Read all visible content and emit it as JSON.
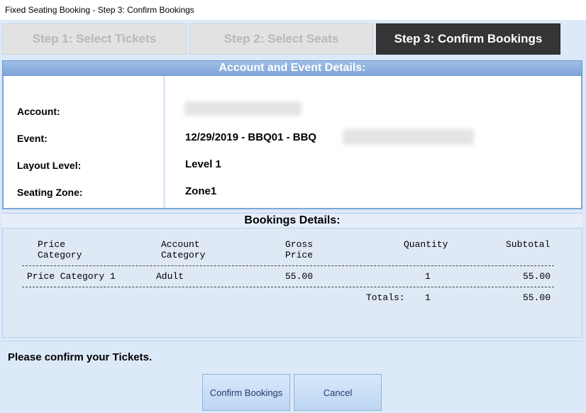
{
  "window": {
    "title": "Fixed Seating Booking - Step 3: Confirm Bookings"
  },
  "steps": [
    {
      "label": "Step 1: Select Tickets",
      "state": "inactive"
    },
    {
      "label": "Step 2: Select Seats",
      "state": "inactive"
    },
    {
      "label": "Step 3: Confirm Bookings",
      "state": "active"
    }
  ],
  "account_section": {
    "header": "Account and Event Details:",
    "fields": {
      "account_label": "Account:",
      "event_label": "Event:",
      "layout_label": "Layout Level:",
      "zone_label": "Seating Zone:",
      "event_value": "12/29/2019 - BBQ01 - BBQ",
      "layout_value": "Level 1",
      "zone_value": "Zone1"
    }
  },
  "bookings_section": {
    "header": "Bookings Details:",
    "columns": {
      "price_category": [
        "Price",
        "Category"
      ],
      "account_category": [
        "Account",
        "Category"
      ],
      "gross_price": [
        "Gross",
        "Price"
      ],
      "quantity": "Quantity",
      "subtotal": "Subtotal"
    },
    "rows": [
      {
        "price_category": "Price Category 1",
        "account_category": "Adult",
        "gross_price": "55.00",
        "quantity": "1",
        "subtotal": "55.00"
      }
    ],
    "totals": {
      "label": "Totals:",
      "quantity": "1",
      "subtotal": "55.00"
    }
  },
  "status_message": "Please confirm your Tickets.",
  "buttons": {
    "confirm": "Confirm Bookings",
    "cancel": "Cancel"
  },
  "colors": {
    "active_step": "#353535",
    "header_blue": "#7ea5d8",
    "window_bg": "#dce9f8"
  }
}
